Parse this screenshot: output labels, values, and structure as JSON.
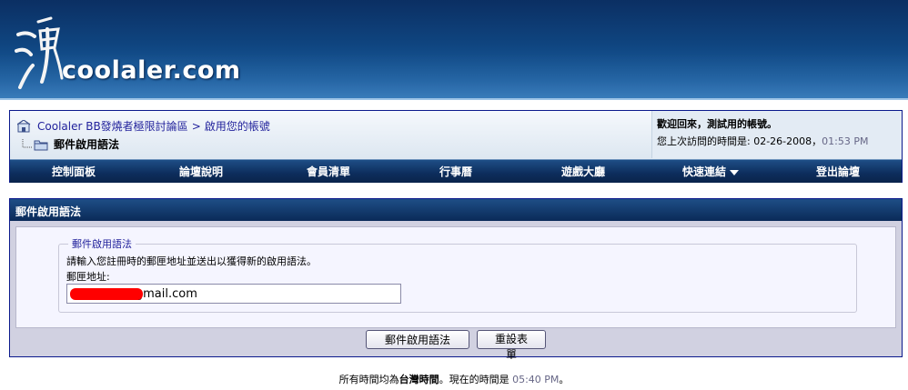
{
  "site": {
    "logo_text": "coolaler.com"
  },
  "breadcrumb": {
    "forum_name": "Coolaler BB發燒者極限討論區",
    "separator": ">",
    "current_link": "啟用您的帳號",
    "page_title": "郵件啟用語法"
  },
  "user": {
    "welcome": "歡迎回來，測試用的帳號。",
    "last_visit_label": "您上次訪問的時間是: 02-26-2008，",
    "last_visit_time": "01:53 PM"
  },
  "navbar": {
    "items": [
      {
        "label": "控制面板"
      },
      {
        "label": "論壇說明"
      },
      {
        "label": "會員清單"
      },
      {
        "label": "行事曆"
      },
      {
        "label": "遊戲大廳"
      },
      {
        "label": "快速連結"
      },
      {
        "label": "登出論壇"
      }
    ]
  },
  "form": {
    "header": "郵件啟用語法",
    "legend": "郵件啟用語法",
    "description": "請輸入您註冊時的郵匣地址並送出以獲得新的啟用語法。",
    "email_label": "郵匣地址:",
    "email_value": "              @gmail.com",
    "submit_label": "郵件啟用語法",
    "reset_label": "重設表單"
  },
  "footer": {
    "prefix": "所有時間均為",
    "timezone": "台灣時間",
    "middle": "。現在的時間是",
    "time": "05:40 PM",
    "suffix": "。"
  },
  "colors": {
    "banner": "#0f4580",
    "nav_bar": "#0d2d5c",
    "link": "#22229c",
    "redaction": "#ff0000"
  },
  "icons": {
    "forum_home": "forum-home-icon",
    "folder": "folder-icon",
    "dropdown": "chevron-down-icon"
  }
}
